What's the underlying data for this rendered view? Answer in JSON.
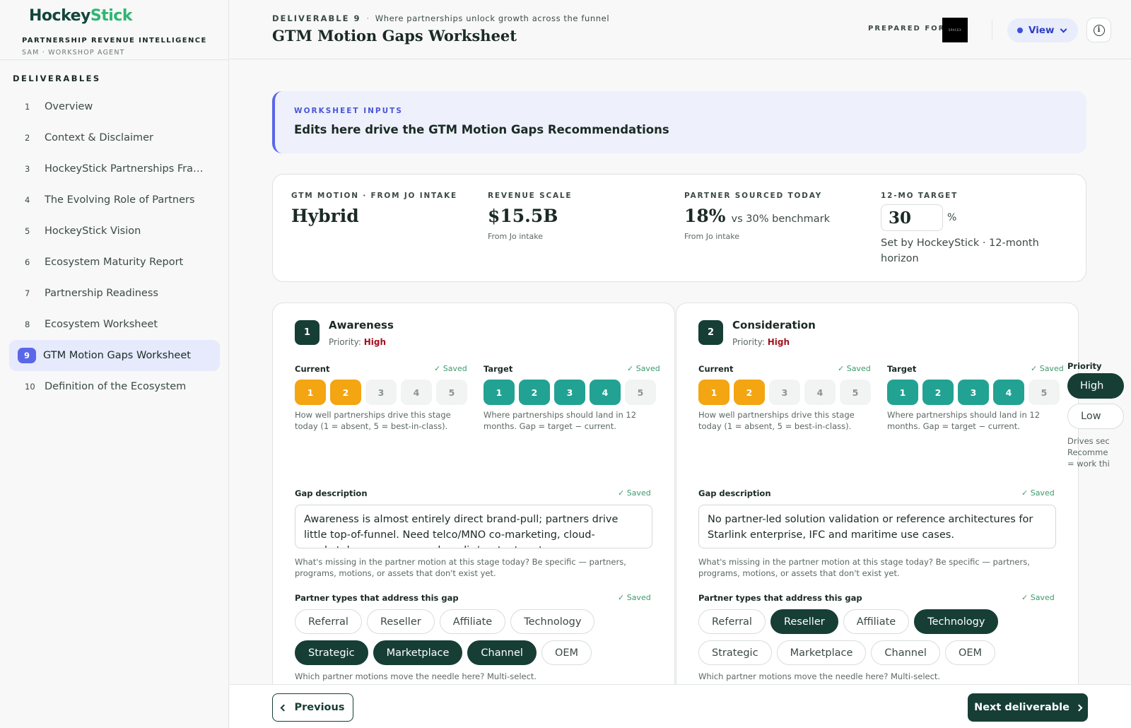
{
  "brand": {
    "name_part1": "Hockey",
    "name_part2": "Stick",
    "subtitle": "PARTNERSHIP REVENUE INTELLIGENCE",
    "user_line": "SAM · WORKSHOP AGENT"
  },
  "sidebar": {
    "heading": "DELIVERABLES",
    "items": [
      {
        "num": "1",
        "label": "Overview"
      },
      {
        "num": "2",
        "label": "Context & Disclaimer"
      },
      {
        "num": "3",
        "label": "HockeyStick Partnerships Fram..."
      },
      {
        "num": "4",
        "label": "The Evolving Role of Partners"
      },
      {
        "num": "5",
        "label": "HockeyStick Vision"
      },
      {
        "num": "6",
        "label": "Ecosystem Maturity Report"
      },
      {
        "num": "7",
        "label": "Partnership Readiness"
      },
      {
        "num": "8",
        "label": "Ecosystem Worksheet"
      },
      {
        "num": "9",
        "label": "GTM Motion Gaps Worksheet",
        "active": true
      },
      {
        "num": "10",
        "label": "Definition of the Ecosystem"
      }
    ]
  },
  "header": {
    "deliverable": "DELIVERABLE 9",
    "tagline": "Where partnerships unlock growth across the funnel",
    "title": "GTM Motion Gaps Worksheet",
    "prepared_for": "PREPARED FOR",
    "view_label": "View",
    "info_glyph": "i"
  },
  "banner": {
    "eyebrow": "WORKSHEET INPUTS",
    "title": "Edits here drive the GTM Motion Gaps Recommendations"
  },
  "metrics": {
    "motion": {
      "label": "GTM MOTION · FROM JO INTAKE",
      "value": "Hybrid"
    },
    "revenue": {
      "label": "REVENUE SCALE",
      "value": "$15.5B",
      "sub": "From Jo intake"
    },
    "sourced": {
      "label": "PARTNER SOURCED TODAY",
      "value": "18%",
      "benchmark": "vs 30% benchmark",
      "sub": "From Jo intake"
    },
    "target": {
      "label": "12-MO TARGET",
      "value": "30",
      "unit": "%",
      "note": "Set by HockeyStick · 12-month horizon"
    }
  },
  "common": {
    "current_label": "Current",
    "target_label": "Target",
    "saved": "✓ Saved",
    "current_hint": "How well partnerships drive this stage today (1 = absent, 5 = best-in-class).",
    "target_hint": "Where partnerships should land in 12 months. Gap = target − current.",
    "gap_label": "Gap description",
    "gap_hint": "What's missing in the partner motion at this stage today? Be specific — partners, programs, motions, or assets that don't exist yet.",
    "partner_label": "Partner types that address this gap",
    "partner_hint": "Which partner motions move the needle here? Multi-select.",
    "priority_prefix": "Priority: ",
    "scale": [
      "1",
      "2",
      "3",
      "4",
      "5"
    ],
    "partner_types": [
      "Referral",
      "Reseller",
      "Affiliate",
      "Technology",
      "Strategic",
      "Marketplace",
      "Channel",
      "OEM"
    ]
  },
  "stages": [
    {
      "num": "1",
      "title": "Awareness",
      "priority": "High",
      "current": 2,
      "target": 4,
      "gap_text": "Awareness is almost entirely direct brand-pull; partners drive little top-of-funnel. Need telco/MNO co-marketing, cloud-marketplace presence and media/content partners.",
      "selected": [
        "Strategic",
        "Marketplace",
        "Channel"
      ]
    },
    {
      "num": "2",
      "title": "Consideration",
      "priority": "High",
      "current": 2,
      "target": 4,
      "gap_text": "No partner-led solution validation or reference architectures for Starlink enterprise, IFC and maritime use cases.",
      "selected": [
        "Reseller",
        "Technology"
      ]
    }
  ],
  "priority_column": {
    "label": "Priority",
    "high": "High",
    "low": "Low",
    "note_lines": [
      "Drives sec",
      "Recomme",
      "= work thi"
    ]
  },
  "footer": {
    "previous": "Previous",
    "next": "Next deliverable"
  }
}
